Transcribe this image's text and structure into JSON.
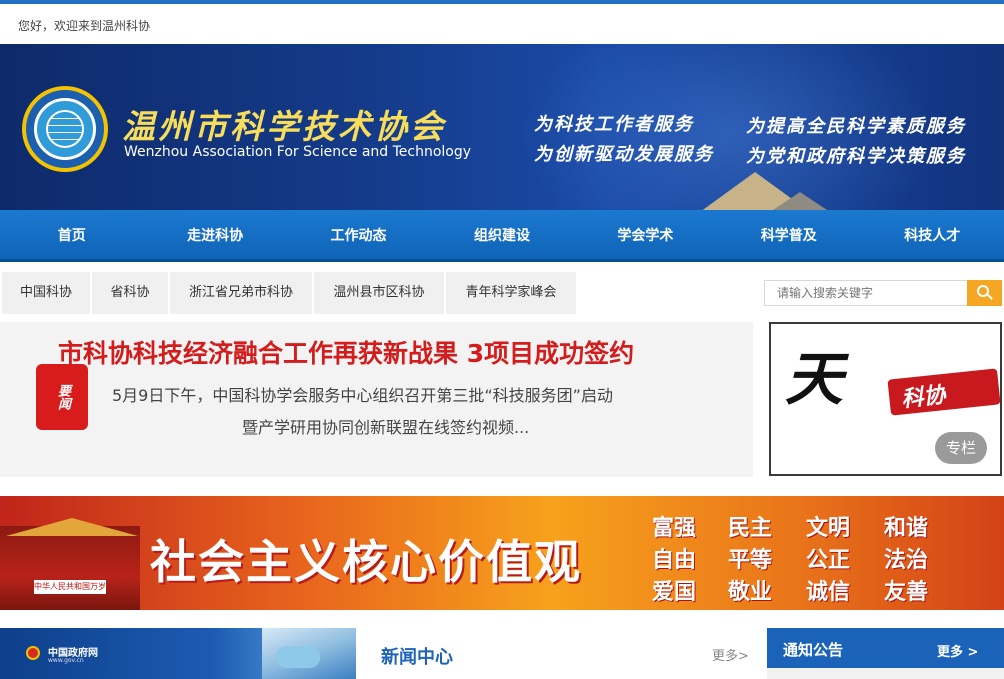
{
  "topbar": {
    "greeting": "您好，欢迎来到温州科协"
  },
  "banner": {
    "org_name_cn": "温州市科学技术协会",
    "org_name_en": "Wenzhou Association For Science and Technology",
    "slogans": [
      "为科技工作者服务",
      "为提高全民科学素质服务",
      "为创新驱动发展服务",
      "为党和政府科学决策服务"
    ]
  },
  "nav": {
    "items": [
      "首页",
      "走进科协",
      "工作动态",
      "组织建设",
      "学会学术",
      "科学普及",
      "科技人才"
    ]
  },
  "links": {
    "items": [
      "中国科协",
      "省科协",
      "浙江省兄弟市科协",
      "温州县市区科协",
      "青年科学家峰会"
    ]
  },
  "search": {
    "placeholder": "请输入搜索关键字",
    "icon": "search-icon"
  },
  "feature": {
    "seal": "要闻",
    "headline": "市科协科技经济融合工作再获新战果 3项目成功签约",
    "summary_line1": "5月9日下午，中国科协学会服务中心组织召开第三批“科技服务团”启动",
    "summary_line2": "暨产学研用协同创新联盟在线签约视频..."
  },
  "column_banner": {
    "calligraphy": "天",
    "red_text": "科协",
    "tag": "专栏"
  },
  "values_banner": {
    "title": "社会主义核心价值观",
    "plaque": "中华人民共和国万岁",
    "words": [
      "富强",
      "民主",
      "文明",
      "和谐",
      "自由",
      "平等",
      "公正",
      "法治",
      "爱国",
      "敬业",
      "诚信",
      "友善"
    ]
  },
  "gov_banner": {
    "name": "中国政府网",
    "url": "www.gov.cn"
  },
  "news": {
    "title": "新闻中心",
    "more": "更多>"
  },
  "notice": {
    "title": "通知公告",
    "more": "更多 >"
  }
}
